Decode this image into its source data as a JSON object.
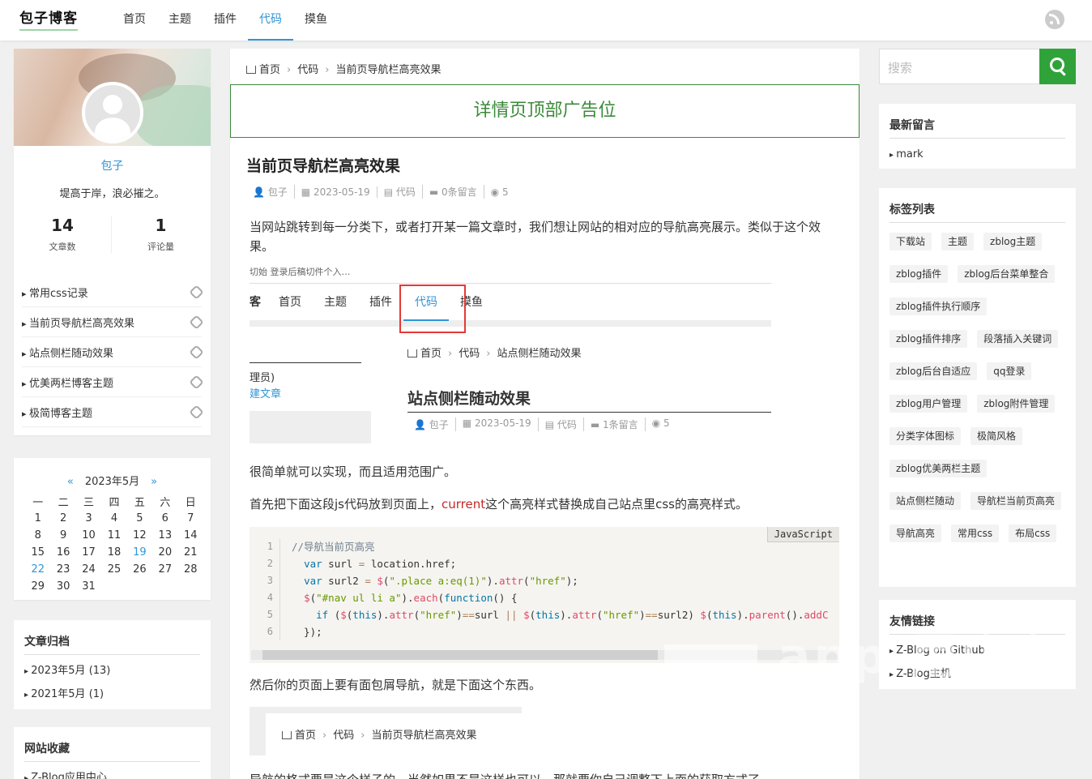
{
  "header": {
    "logo": "包子博客",
    "nav": [
      "首页",
      "主题",
      "插件",
      "代码",
      "摸鱼"
    ],
    "active_index": 3
  },
  "profile": {
    "name": "包子",
    "motto": "堤高于岸，浪必摧之。",
    "stats": [
      {
        "num": "14",
        "label": "文章数"
      },
      {
        "num": "1",
        "label": "评论量"
      }
    ],
    "links": [
      "常用css记录",
      "当前页导航栏高亮效果",
      "站点侧栏随动效果",
      "优美两栏博客主题",
      "极简博客主题"
    ]
  },
  "calendar": {
    "title": "2023年5月",
    "prev": "«",
    "next": "»",
    "weekdays": [
      "一",
      "二",
      "三",
      "四",
      "五",
      "六",
      "日"
    ],
    "weeks": [
      [
        "1",
        "2",
        "3",
        "4",
        "5",
        "6",
        "7"
      ],
      [
        "8",
        "9",
        "10",
        "11",
        "12",
        "13",
        "14"
      ],
      [
        "15",
        "16",
        "17",
        "18",
        "19",
        "20",
        "21"
      ],
      [
        "22",
        "23",
        "24",
        "25",
        "26",
        "27",
        "28"
      ],
      [
        "29",
        "30",
        "31",
        "",
        "",
        "",
        ""
      ]
    ],
    "highlight": [
      "19",
      "22"
    ]
  },
  "archive": {
    "title": "文章归档",
    "items": [
      "2023年5月 (13)",
      "2021年5月 (1)"
    ]
  },
  "favorites": {
    "title": "网站收藏",
    "items": [
      "Z-Blog应用中心"
    ]
  },
  "main": {
    "breadcrumb": [
      "首页",
      "代码",
      "当前页导航栏高亮效果"
    ],
    "ad": "详情页顶部广告位",
    "title": "当前页导航栏高亮效果",
    "meta": [
      "包子",
      "2023-05-19",
      "代码",
      "0条留言",
      "5"
    ],
    "p1": "当网站跳转到每一分类下，或者打开某一篇文章时，我们想让网站的相对应的导航高亮展示。类似于这个效果。",
    "p2": "很简单就可以实现，而且适用范围广。",
    "p3_a": "首先把下面这段js代码放到页面上，",
    "p3_current": "current",
    "p3_b": "这个高亮样式替换成自己站点里css的高亮样式。",
    "p4": "然后你的页面上要有面包屑导航，就是下面这个东西。",
    "p5_a": "导航的格式要是这个样子的，当然如果不是这样也可以，那就要你自己调整下上面",
    "p5_b": "的获取方式了。",
    "code_lang": "JavaScript",
    "code_lines": [
      "1",
      "2",
      "3",
      "4",
      "5",
      "6"
    ]
  },
  "screenshot1": {
    "logo_tail": "客",
    "nav": [
      "首页",
      "主题",
      "插件",
      "代码",
      "摸鱼"
    ],
    "top_fragment": "切始 登录后稿切件个入…",
    "side_text1": "理员)",
    "side_text2": "建文章",
    "breadcrumb": [
      "首页",
      "代码",
      "站点侧栏随动效果"
    ],
    "title": "站点侧栏随动效果",
    "meta": [
      "包子",
      "2023-05-19",
      "代码",
      "1条留言",
      "5"
    ]
  },
  "screenshot2": {
    "breadcrumb": [
      "首页",
      "代码",
      "当前页导航栏高亮效果"
    ]
  },
  "right": {
    "search_placeholder": "搜索",
    "recent_title": "最新留言",
    "recent": [
      "mark"
    ],
    "tags_title": "标签列表",
    "tags": [
      "下载站",
      "主题",
      "zblog主题",
      "zblog插件",
      "zblog后台菜单整合",
      "zblog插件执行顺序",
      "zblog插件排序",
      "段落插入关键词",
      "zblog后台自适应",
      "qq登录",
      "zblog用户管理",
      "zblog附件管理",
      "分类字体图标",
      "极简风格",
      "zblog优美两栏主题",
      "站点侧栏随动",
      "导航栏当前页高亮",
      "导航高亮",
      "常用css",
      "布局css"
    ],
    "links_title": "友情链接",
    "links": [
      "Z-Blog on Github",
      "Z-Blog主机"
    ]
  },
  "watermark": "app 用中心",
  "colors": {
    "accent": "#2f95d8",
    "green": "#3b8a3a",
    "search_btn": "#2fa33a",
    "current": "#c62828"
  }
}
